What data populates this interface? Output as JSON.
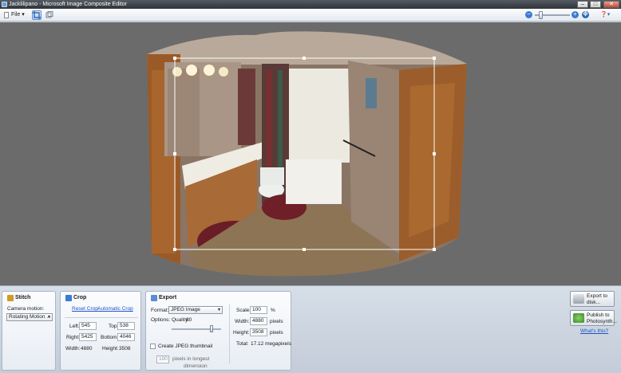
{
  "window": {
    "title": "Jacklilipano - Microsoft Image Composite Editor",
    "minimize": "–",
    "maximize": "□",
    "close": "✕"
  },
  "toolbar": {
    "file_menu": "File ▾",
    "crop_tool_icon": "crop-icon",
    "view_tool_icon": "3d-view-icon",
    "zoom_out": "−",
    "zoom_in": "+",
    "fit": "✥",
    "help": "❓▾"
  },
  "canvas": {
    "background": "#6b6b6b"
  },
  "stitch": {
    "title": "Stitch",
    "camera_motion_label": "Camera motion:",
    "camera_motion_value": "Rotating Motion ..."
  },
  "crop": {
    "title": "Crop",
    "reset_crop": "Reset Crop",
    "automatic_crop": "Automatic Crop",
    "left_label": "Left:",
    "left_value": "545",
    "top_label": "Top:",
    "top_value": "538",
    "right_label": "Right:",
    "right_value": "5425",
    "bottom_label": "Bottom:",
    "bottom_value": "4046",
    "width_label": "Width:",
    "width_value": "4880",
    "height_label": "Height:",
    "height_value": "3508"
  },
  "export": {
    "title": "Export",
    "format_label": "Format:",
    "format_value": "JPEG Image",
    "options_label": "Options:",
    "quality_label": "Quality:",
    "quality_value": "80",
    "quality_level": 0.8,
    "thumbnail_label": "Create JPEG thumbnail",
    "thumbnail_value": "100",
    "thumbnail_suffix_1": "pixels in longest",
    "thumbnail_suffix_2": "dimension",
    "scale_label": "Scale:",
    "scale_value": "100",
    "scale_unit": "%",
    "width_label": "Width:",
    "width_value": "4880",
    "width_unit": "pixels",
    "height_label": "Height:",
    "height_value": "3508",
    "height_unit": "pixels",
    "total_label": "Total:",
    "total_value": "17.12 megapixels"
  },
  "actions": {
    "export_to_disk": "Export to disk...",
    "publish": "Publish to Photosynth...",
    "whats_this": "What's this?"
  }
}
